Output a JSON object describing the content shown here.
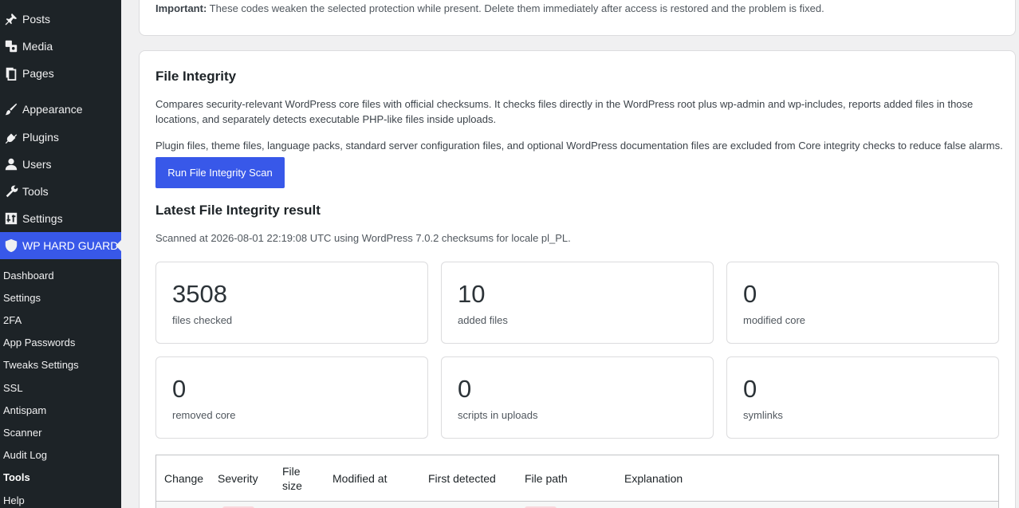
{
  "sidebar": {
    "menu": [
      {
        "label": "Posts",
        "icon": "pin-icon"
      },
      {
        "label": "Media",
        "icon": "media-icon"
      },
      {
        "label": "Pages",
        "icon": "pages-icon"
      },
      {
        "label": "Appearance",
        "icon": "brush-icon"
      },
      {
        "label": "Plugins",
        "icon": "plugin-icon"
      },
      {
        "label": "Users",
        "icon": "user-icon"
      },
      {
        "label": "Tools",
        "icon": "wrench-icon"
      },
      {
        "label": "Settings",
        "icon": "settings-icon"
      },
      {
        "label": "WP HARD GUARD",
        "icon": "shield-icon"
      }
    ],
    "submenu": [
      "Dashboard",
      "Settings",
      "2FA",
      "App Passwords",
      "Tweaks Settings",
      "SSL",
      "Antispam",
      "Scanner",
      "Audit Log",
      "Tools",
      "Help"
    ],
    "current_submenu": "Tools",
    "accent": "#3858e9"
  },
  "top_notice": {
    "label": "Important:",
    "text": "These codes weaken the selected protection while present. Delete them immediately after access is restored and the problem is fixed."
  },
  "file_integrity": {
    "title": "File Integrity",
    "description": "Compares security-relevant WordPress core files with official checksums. It checks files directly in the WordPress root plus wp-admin and wp-includes, reports added files in those locations, and separately detects executable PHP-like files inside uploads.",
    "exclusions": "Plugin files, theme files, language packs, standard server configuration files, and optional WordPress documentation files are excluded from Core integrity checks to reduce false alarms.",
    "button": "Run File Integrity Scan",
    "latest_title": "Latest File Integrity result",
    "scan_meta": "Scanned at 2026-08-01 22:19:08 UTC using WordPress 7.0.2 checksums for locale pl_PL.",
    "stats": [
      {
        "value": "3508",
        "label": "files checked"
      },
      {
        "value": "10",
        "label": "added files"
      },
      {
        "value": "0",
        "label": "modified core"
      },
      {
        "value": "0",
        "label": "removed core"
      },
      {
        "value": "0",
        "label": "scripts in uploads"
      },
      {
        "value": "0",
        "label": "symlinks"
      }
    ],
    "table_headers": [
      "Change",
      "Severity",
      "File size",
      "Modified at",
      "First detected",
      "File path",
      "Explanation"
    ]
  }
}
